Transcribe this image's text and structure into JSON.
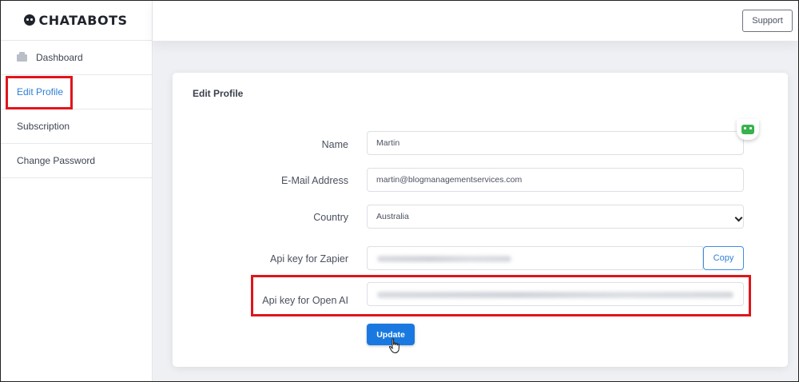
{
  "brand": {
    "logo_text": "CHATABOTS"
  },
  "sidebar": {
    "items": [
      {
        "label": "Dashboard",
        "icon": "dashboard-icon"
      },
      {
        "label": "Edit Profile",
        "active": true
      },
      {
        "label": "Subscription"
      },
      {
        "label": "Change Password"
      }
    ]
  },
  "topbar": {
    "support_label": "Support"
  },
  "form": {
    "title": "Edit Profile",
    "name_label": "Name",
    "name_value": "Martin",
    "email_label": "E-Mail Address",
    "email_value": "martin@blogmanagementservices.com",
    "country_label": "Country",
    "country_value": "Australia",
    "zapier_label": "Api key for Zapier",
    "copy_label": "Copy",
    "openai_label": "Api key for Open AI",
    "update_label": "Update"
  },
  "colors": {
    "accent": "#1979e0",
    "active_link": "#2f7fd6",
    "highlight_box": "#e0151b",
    "bot_badge": "#37b24d"
  }
}
